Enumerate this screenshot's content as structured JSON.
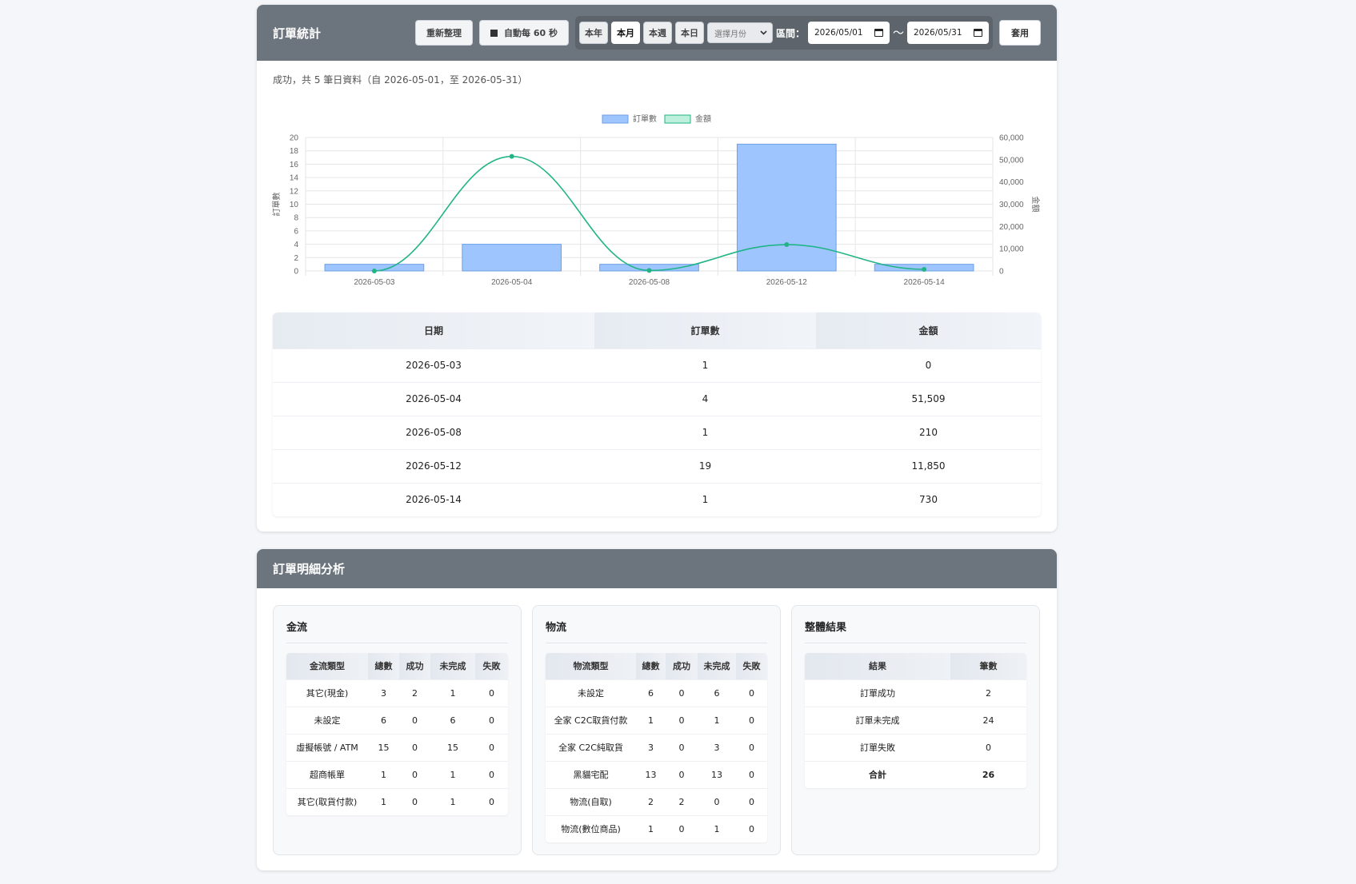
{
  "stats": {
    "title": "訂單統計",
    "refresh_label": "重新整理",
    "auto_label": "自動每 60 秒",
    "period_buttons": [
      "本年",
      "本月",
      "本週",
      "本日"
    ],
    "active_period": "本月",
    "month_select_placeholder": "選擇月份",
    "range_label": "區間：",
    "start_date": "2026/05/01",
    "range_separator": "〜",
    "end_date": "2026/05/31",
    "apply_label": "套用",
    "status_text": "成功，共 5 筆日資料（自 2026-05-01，至 2026-05-31）"
  },
  "chart_data": {
    "type": "bar",
    "categories": [
      "2026-05-03",
      "2026-05-04",
      "2026-05-08",
      "2026-05-12",
      "2026-05-14"
    ],
    "series": [
      {
        "name": "訂單數",
        "type": "bar",
        "axis": "left",
        "values": [
          1,
          4,
          1,
          19,
          1
        ],
        "color": "#9ec5fe"
      },
      {
        "name": "金額",
        "type": "line",
        "axis": "right",
        "values": [
          0,
          51509,
          210,
          11850,
          730
        ],
        "color": "#20b486"
      }
    ],
    "ylabel": "訂單數",
    "ylim": [
      0,
      20
    ],
    "yticks": [
      0,
      2,
      4,
      6,
      8,
      10,
      12,
      14,
      16,
      18,
      20
    ],
    "y2label": "金額",
    "y2lim": [
      0,
      60000
    ],
    "y2ticks": [
      "0",
      "10,000",
      "20,000",
      "30,000",
      "40,000",
      "50,000",
      "60,000"
    ],
    "grid": true,
    "legend_position": "top"
  },
  "daily_table": {
    "headers": [
      "日期",
      "訂單數",
      "金額"
    ],
    "rows": [
      [
        "2026-05-03",
        "1",
        "0"
      ],
      [
        "2026-05-04",
        "4",
        "51,509"
      ],
      [
        "2026-05-08",
        "1",
        "210"
      ],
      [
        "2026-05-12",
        "19",
        "11,850"
      ],
      [
        "2026-05-14",
        "1",
        "730"
      ]
    ]
  },
  "analysis": {
    "title": "訂單明細分析",
    "payment": {
      "title": "金流",
      "headers": [
        "金流類型",
        "總數",
        "成功",
        "未完成",
        "失敗"
      ],
      "rows": [
        [
          "其它(現金)",
          "3",
          "2",
          "1",
          "0"
        ],
        [
          "未設定",
          "6",
          "0",
          "6",
          "0"
        ],
        [
          "虛擬帳號 / ATM",
          "15",
          "0",
          "15",
          "0"
        ],
        [
          "超商帳單",
          "1",
          "0",
          "1",
          "0"
        ],
        [
          "其它(取貨付款)",
          "1",
          "0",
          "1",
          "0"
        ]
      ]
    },
    "logistics": {
      "title": "物流",
      "headers": [
        "物流類型",
        "總數",
        "成功",
        "未完成",
        "失敗"
      ],
      "rows": [
        [
          "未設定",
          "6",
          "0",
          "6",
          "0"
        ],
        [
          "全家 C2C取貨付款",
          "1",
          "0",
          "1",
          "0"
        ],
        [
          "全家 C2C純取貨",
          "3",
          "0",
          "3",
          "0"
        ],
        [
          "黑貓宅配",
          "13",
          "0",
          "13",
          "0"
        ],
        [
          "物流(自取)",
          "2",
          "2",
          "0",
          "0"
        ],
        [
          "物流(數位商品)",
          "1",
          "0",
          "1",
          "0"
        ]
      ]
    },
    "overall": {
      "title": "整體結果",
      "headers": [
        "結果",
        "筆數"
      ],
      "rows": [
        [
          "訂單成功",
          "2"
        ],
        [
          "訂單未完成",
          "24"
        ],
        [
          "訂單失敗",
          "0"
        ],
        [
          "合計",
          "26"
        ]
      ]
    }
  }
}
